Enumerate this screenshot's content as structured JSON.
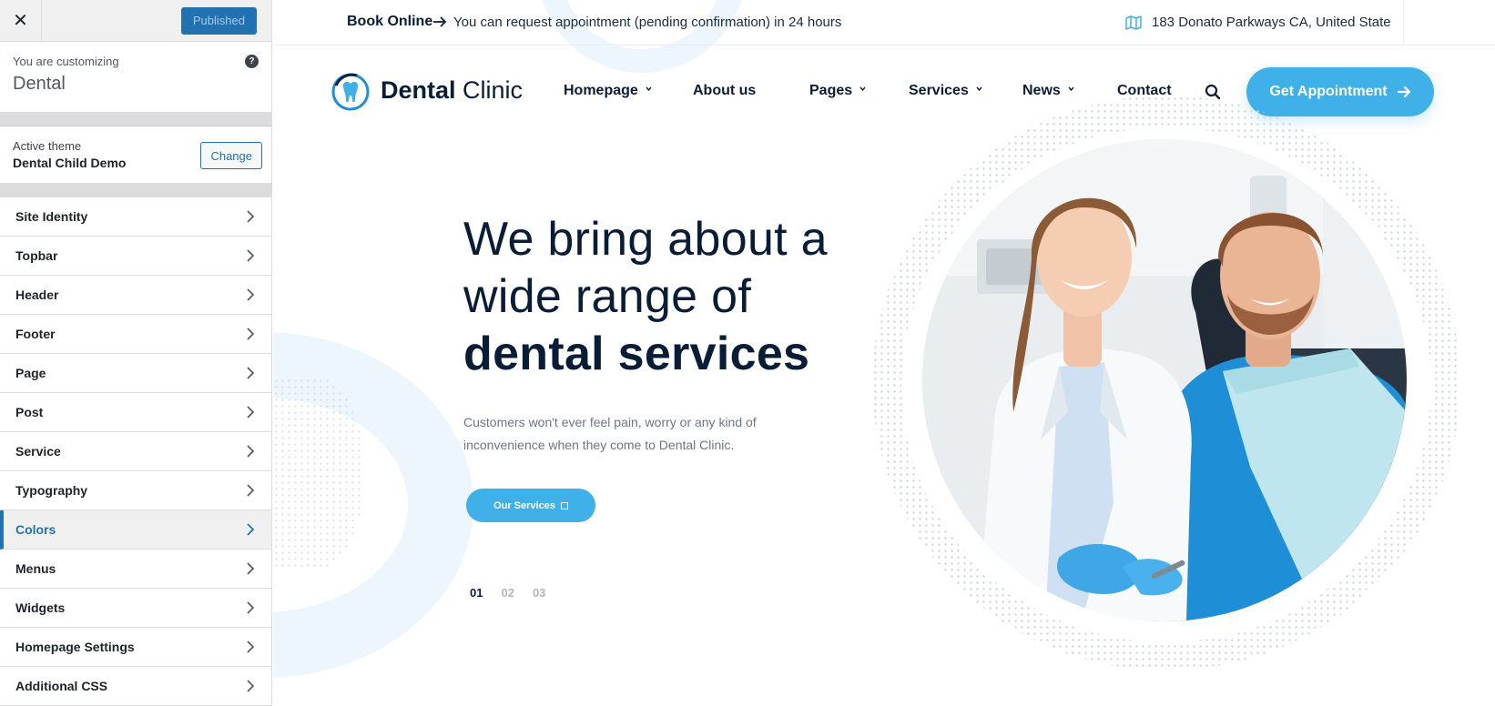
{
  "customizer": {
    "close_glyph": "✕",
    "publish_label": "Published",
    "customizing_label": "You are customizing",
    "site_name": "Dental",
    "help_glyph": "?",
    "active_theme_label": "Active theme",
    "theme_name": "Dental Child Demo",
    "change_label": "Change",
    "sections": [
      {
        "label": "Site Identity"
      },
      {
        "label": "Topbar"
      },
      {
        "label": "Header"
      },
      {
        "label": "Footer"
      },
      {
        "label": "Page"
      },
      {
        "label": "Post"
      },
      {
        "label": "Service"
      },
      {
        "label": "Typography"
      },
      {
        "label": "Colors",
        "active": true
      },
      {
        "label": "Menus"
      },
      {
        "label": "Widgets"
      },
      {
        "label": "Homepage Settings"
      },
      {
        "label": "Additional CSS"
      }
    ]
  },
  "site": {
    "topbar": {
      "book_label": "Book Online",
      "notice": "You can request appointment (pending confirmation) in 24 hours",
      "address": "183 Donato Parkways CA, United State",
      "icons": [
        "arrow-right-icon",
        "map-icon"
      ]
    },
    "brand": {
      "bold": "Dental",
      "light": "Clinic",
      "logo_icon": "tooth-logo-icon"
    },
    "nav": {
      "homepage": "Homepage",
      "about": "About us",
      "pages": "Pages",
      "services": "Services",
      "news": "News",
      "contact": "Contact"
    },
    "cta_label": "Get Appointment",
    "hero": {
      "title_line1": "We bring about a",
      "title_line2": "wide range of",
      "title_line3": "dental services",
      "text": "Customers won't ever feel pain, worry or any kind of inconvenience when they come to Dental Clinic.",
      "button_label": "Our Services",
      "slides": [
        "01",
        "02",
        "03"
      ],
      "current_slide": "01"
    },
    "colors": {
      "accent": "#3fb0e8",
      "navy": "#0a1d37",
      "wp_blue": "#2271b1",
      "scrub_blue": "#1e8ed6"
    }
  }
}
